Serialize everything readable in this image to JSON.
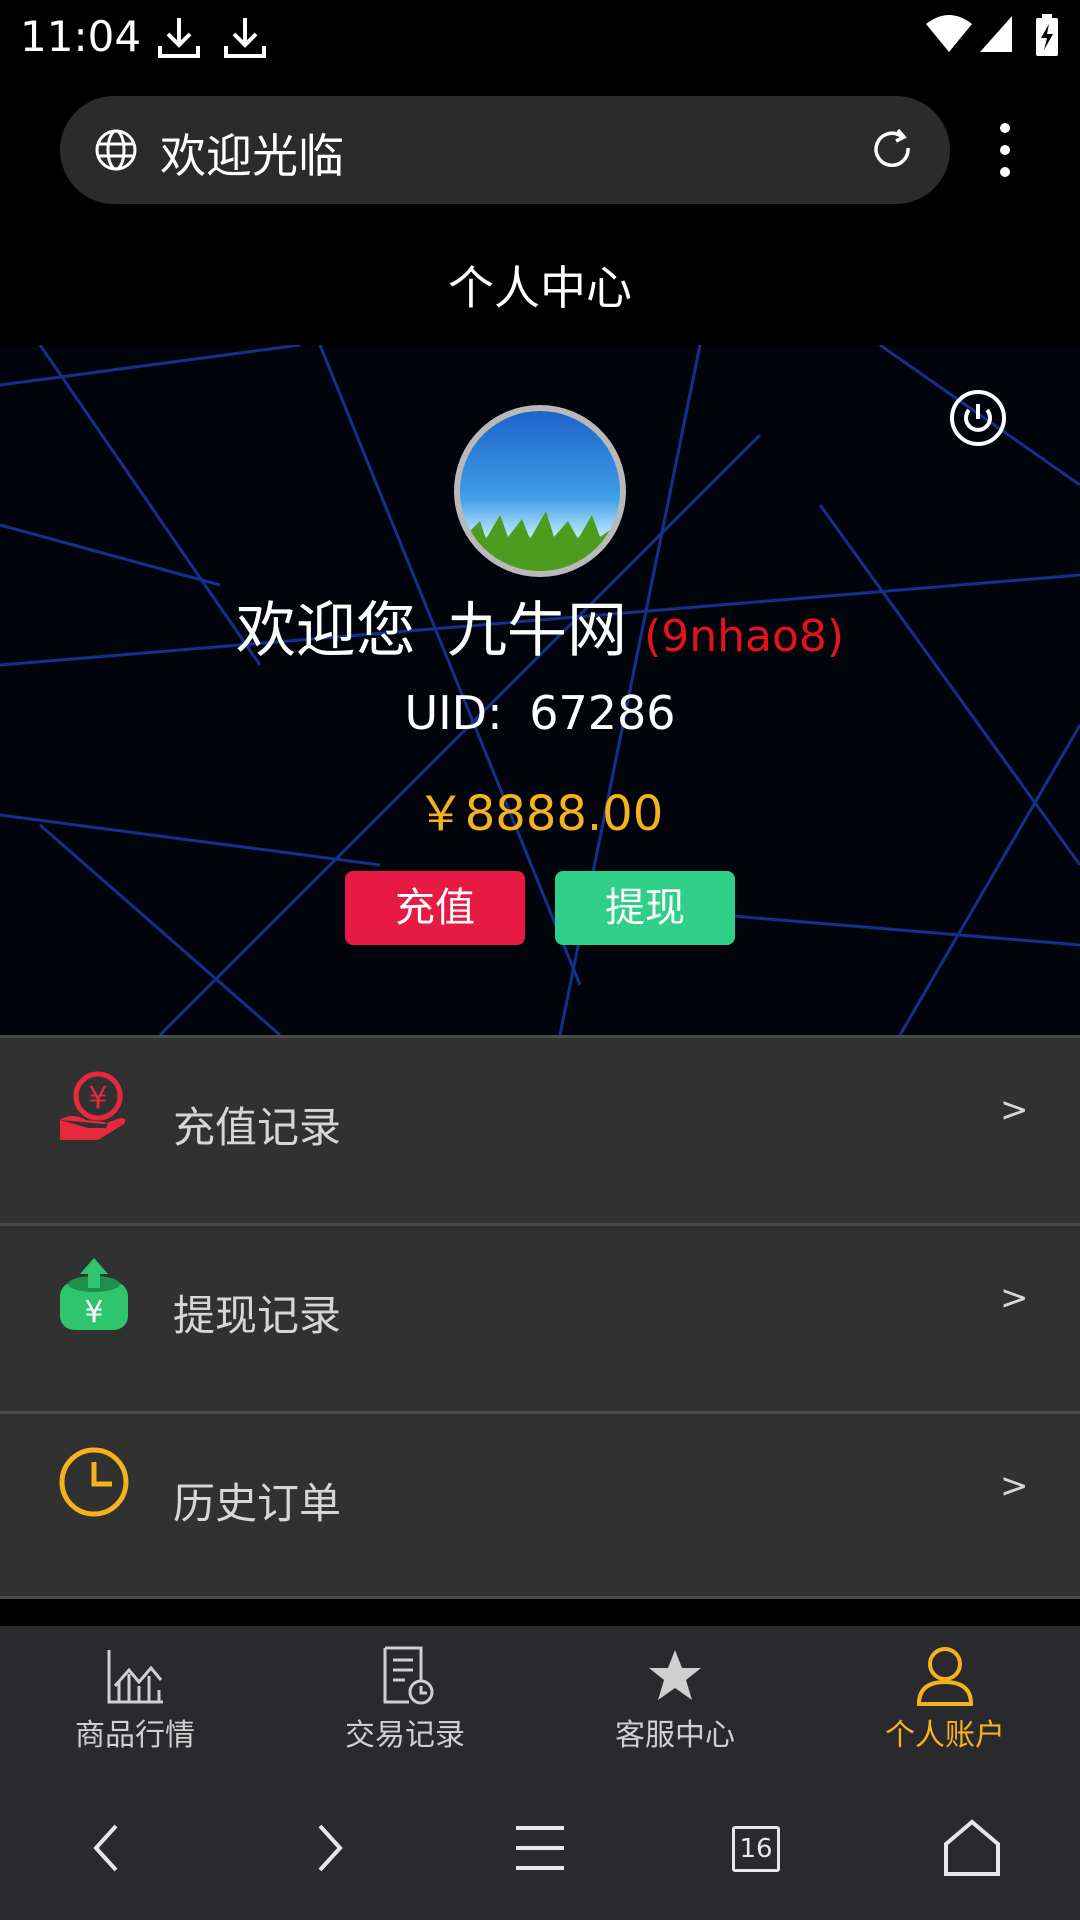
{
  "status_bar": {
    "time": "11:04"
  },
  "browser": {
    "url_title": "欢迎光临",
    "tab_count": "16"
  },
  "page": {
    "title": "个人中心"
  },
  "profile": {
    "welcome": "欢迎您",
    "site_name": "九牛网",
    "nickname": "(9nhao8)",
    "uid_label": "UID:",
    "uid": "67286",
    "balance": "￥8888.00"
  },
  "actions": {
    "recharge": "充值",
    "withdraw": "提现"
  },
  "menu": [
    {
      "label": "充值记录",
      "icon": "hand-yen-icon",
      "arrow": ">"
    },
    {
      "label": "提现记录",
      "icon": "yen-upload-icon",
      "arrow": ">"
    },
    {
      "label": "历史订单",
      "icon": "clock-icon",
      "arrow": ">"
    }
  ],
  "tabs": [
    {
      "label": "商品行情",
      "icon": "bar-chart-icon"
    },
    {
      "label": "交易记录",
      "icon": "document-clock-icon"
    },
    {
      "label": "客服中心",
      "icon": "star-icon"
    },
    {
      "label": "个人账户",
      "icon": "user-icon",
      "active": true
    }
  ],
  "colors": {
    "accent": "#f5b21d",
    "recharge": "#e71a44",
    "withdraw": "#2fcf8a",
    "nickname": "#e5121b"
  }
}
